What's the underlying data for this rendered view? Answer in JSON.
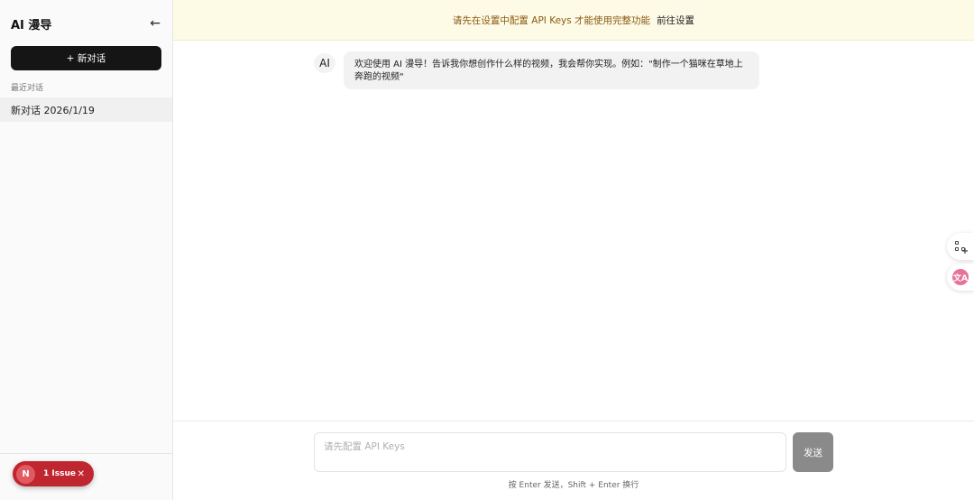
{
  "sidebar": {
    "title": "AI 漫导",
    "collapse_icon": "←",
    "new_chat_label": "+ 新对话",
    "recent_label": "最近对话",
    "conversations": [
      {
        "label": "新对话 2026/1/19"
      }
    ]
  },
  "issue_badge": {
    "logo": "N",
    "text": "1 Issue",
    "close": "✕"
  },
  "banner": {
    "message": "请先在设置中配置 API Keys 才能使用完整功能",
    "link_label": "前往设置"
  },
  "chat": {
    "messages": [
      {
        "role_label": "AI",
        "text": "欢迎使用 AI 漫导！告诉我你想创作什么样的视频，我会帮你实现。例如：\"制作一个猫咪在草地上奔跑的视频\""
      }
    ]
  },
  "floating": {
    "translate_glyph": "文A"
  },
  "composer": {
    "placeholder": "请先配置 API Keys",
    "send_label": "发送",
    "hint": "按 Enter 发送，Shift + Enter 换行"
  },
  "colors": {
    "banner_bg": "#fdfbe6",
    "banner_text": "#8a5a12",
    "primary_button": "#151515",
    "issue_red": "#c0262f",
    "send_disabled": "#8a8a8a"
  }
}
